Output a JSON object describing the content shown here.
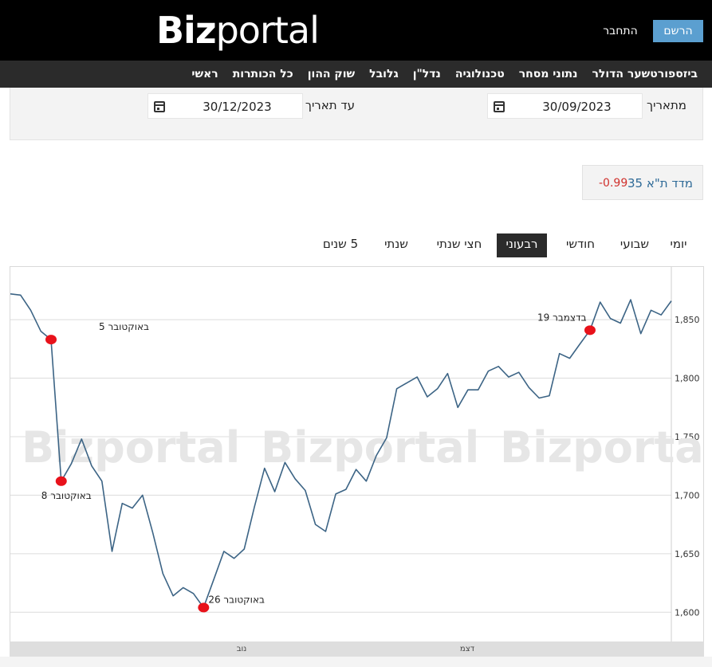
{
  "header": {
    "logo_bold": "Biz",
    "logo_light": "portal",
    "register_label": "הרשם",
    "login_label": "התחבר"
  },
  "nav": {
    "items": [
      "ראשי",
      "כל הכותרות",
      "שוק ההון",
      "גלובל",
      "נדל\"ן",
      "טכנולוגיה",
      "נתוני מסחר",
      "שער הדולר",
      "ביזספורט"
    ]
  },
  "filters": {
    "from_label": "מתאריך",
    "from_value": "30/09/2023",
    "to_label": "עד תאריך",
    "to_value": "30/12/2023"
  },
  "index": {
    "name": "מדד ת\"א 35",
    "change": "-0.99"
  },
  "tabs": {
    "items": [
      "יומי",
      "שבועי",
      "חודשי",
      "רבעוני",
      "חצי שנתי",
      "שנתי",
      "5 שנים"
    ],
    "active": "רבעוני"
  },
  "colors": {
    "line": "#3c6485",
    "marker": "#e8121b",
    "negative": "#d0312d",
    "register_button": "#5b9fd0",
    "index_name": "#2e6a97"
  },
  "chart_data": {
    "type": "line",
    "y_axis_position": "right",
    "ylim": [
      1575,
      1895
    ],
    "yticks": [
      1600,
      1650,
      1700,
      1750,
      1800,
      1850
    ],
    "yticks_labels": [
      "1,600",
      "1,650",
      "1,700",
      "1,750",
      "1,800",
      "1,850"
    ],
    "x_tick_labels": [
      "נוב",
      "דצמ"
    ],
    "watermark": "Bizportal",
    "grid": true,
    "series": [
      {
        "values": [
          1872,
          1871,
          1858,
          1840,
          1833,
          1712,
          1727,
          1748,
          1725,
          1712,
          1652,
          1693,
          1689,
          1700,
          1668,
          1633,
          1614,
          1621,
          1616,
          1604,
          1628,
          1652,
          1646,
          1654,
          1690,
          1723,
          1703,
          1728,
          1714,
          1704,
          1675,
          1669,
          1701,
          1705,
          1722,
          1712,
          1734,
          1749,
          1791,
          1796,
          1801,
          1784,
          1791,
          1804,
          1775,
          1790,
          1790,
          1806,
          1810,
          1801,
          1805,
          1792,
          1783,
          1785,
          1821,
          1817,
          1829,
          1841,
          1865,
          1851,
          1847,
          1867,
          1838,
          1858,
          1854,
          1866
        ]
      }
    ],
    "annotations": [
      {
        "point_index": 4,
        "label": "5 באוקטובר"
      },
      {
        "point_index": 5,
        "label": "8 באוקטובר"
      },
      {
        "point_index": 19,
        "label": "26 באוקטובר"
      },
      {
        "point_index": 57,
        "label": "19 בדצמבר"
      }
    ]
  }
}
